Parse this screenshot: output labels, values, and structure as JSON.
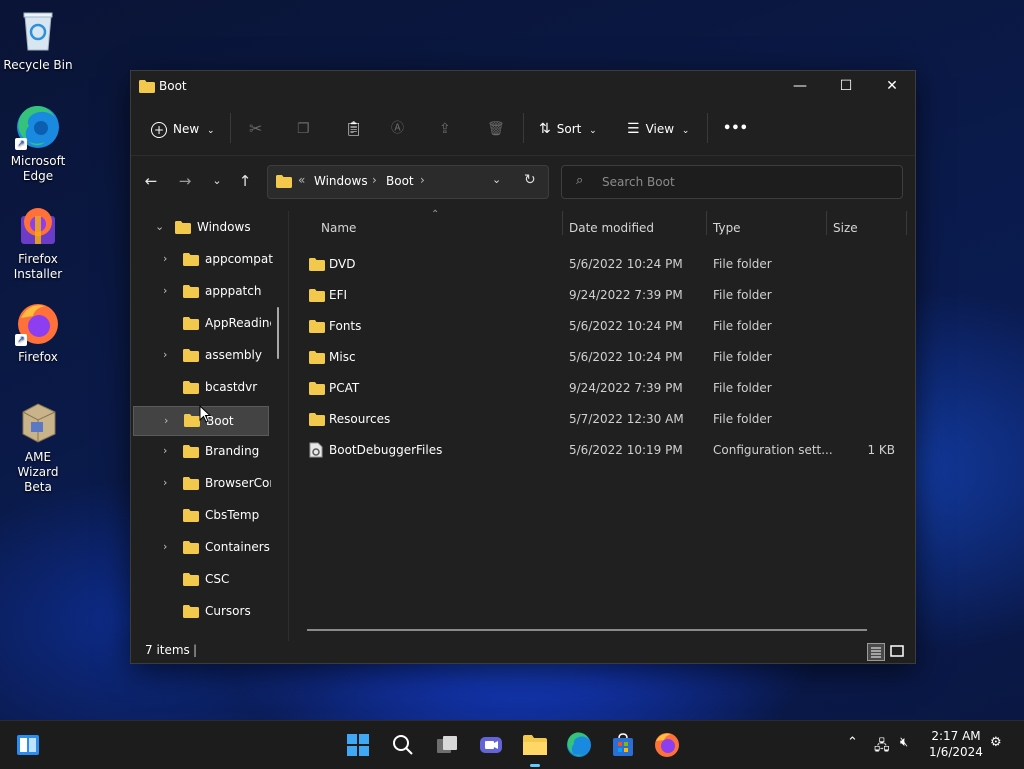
{
  "desktop": {
    "icons": [
      {
        "label": "Recycle Bin"
      },
      {
        "label": "Microsoft Edge"
      },
      {
        "label": "Firefox Installer"
      },
      {
        "label": "Firefox"
      },
      {
        "label": "AME Wizard Beta"
      }
    ]
  },
  "window": {
    "title": "Boot",
    "controls": {
      "minimize": "—",
      "maximize": "☐",
      "close": "✕"
    }
  },
  "command_bar": {
    "new_label": "New",
    "sort_label": "Sort",
    "view_label": "View",
    "more_label": "•••"
  },
  "address_bar": {
    "overflow": "«",
    "crumbs": [
      "Windows",
      "Boot"
    ]
  },
  "search": {
    "placeholder": "Search Boot"
  },
  "nav_tree": {
    "items": [
      {
        "label": "Windows",
        "expanded": true
      },
      {
        "label": "appcompat",
        "has_children": true
      },
      {
        "label": "apppatch",
        "has_children": true
      },
      {
        "label": "AppReadiness",
        "has_children": false
      },
      {
        "label": "assembly",
        "has_children": true
      },
      {
        "label": "bcastdvr",
        "has_children": false
      },
      {
        "label": "Boot",
        "has_children": true,
        "selected": true
      },
      {
        "label": "Branding",
        "has_children": true
      },
      {
        "label": "BrowserCore",
        "has_children": true
      },
      {
        "label": "CbsTemp",
        "has_children": false
      },
      {
        "label": "Containers",
        "has_children": true
      },
      {
        "label": "CSC",
        "has_children": false
      },
      {
        "label": "Cursors",
        "has_children": false
      }
    ]
  },
  "file_list": {
    "columns": [
      "Name",
      "Date modified",
      "Type",
      "Size"
    ],
    "rows": [
      {
        "name": "DVD",
        "date": "5/6/2022 10:24 PM",
        "type": "File folder",
        "size": "",
        "icon": "folder-icon"
      },
      {
        "name": "EFI",
        "date": "9/24/2022 7:39 PM",
        "type": "File folder",
        "size": "",
        "icon": "folder-icon"
      },
      {
        "name": "Fonts",
        "date": "5/6/2022 10:24 PM",
        "type": "File folder",
        "size": "",
        "icon": "folder-icon"
      },
      {
        "name": "Misc",
        "date": "5/6/2022 10:24 PM",
        "type": "File folder",
        "size": "",
        "icon": "folder-icon"
      },
      {
        "name": "PCAT",
        "date": "9/24/2022 7:39 PM",
        "type": "File folder",
        "size": "",
        "icon": "folder-icon"
      },
      {
        "name": "Resources",
        "date": "5/7/2022 12:30 AM",
        "type": "File folder",
        "size": "",
        "icon": "folder-icon"
      },
      {
        "name": "BootDebuggerFiles",
        "date": "5/6/2022 10:19 PM",
        "type": "Configuration sett...",
        "size": "1 KB",
        "icon": "config-file-icon"
      }
    ]
  },
  "status_bar": {
    "item_count": "7 items"
  },
  "taskbar": {
    "clock_time": "2:17 AM",
    "clock_date": "1/6/2024"
  },
  "colors": {
    "folder": "#f2c94c",
    "accent": "#60cdff",
    "window_bg": "#202020",
    "selection": "#434343"
  }
}
